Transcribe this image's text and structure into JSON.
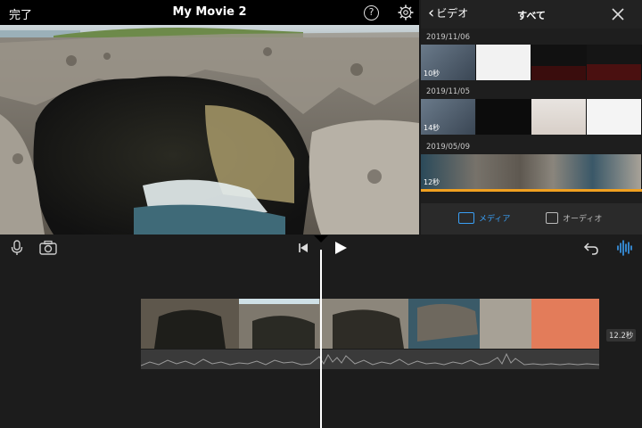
{
  "topbar": {
    "done_label": "完了",
    "title": "My Movie 2",
    "help_label": "?",
    "settings_icon": "gear-icon"
  },
  "viewer": {
    "scene": "coastal-rock-cave"
  },
  "browser": {
    "back_label": "ビデオ",
    "title": "すべて",
    "close_icon": "close-icon",
    "groups": [
      {
        "date": "2019/11/06",
        "thumbs": [
          {
            "duration": "10秒"
          },
          {
            "duration": ""
          },
          {
            "duration": ""
          },
          {
            "duration": ""
          }
        ]
      },
      {
        "date": "2019/11/05",
        "thumbs": [
          {
            "duration": "14秒"
          },
          {
            "duration": ""
          },
          {
            "duration": ""
          },
          {
            "duration": ""
          }
        ]
      },
      {
        "date": "2019/05/09",
        "thumbs": [
          {
            "duration": "12秒"
          }
        ]
      }
    ],
    "tabs": [
      {
        "label": "メディア",
        "active": true
      },
      {
        "label": "オーディオ",
        "active": false
      }
    ]
  },
  "timeline": {
    "clip_duration": "12.2秒"
  },
  "colors": {
    "accent": "#3a9ff5",
    "selection": "#f0a020",
    "background": "#1c1c1c"
  }
}
